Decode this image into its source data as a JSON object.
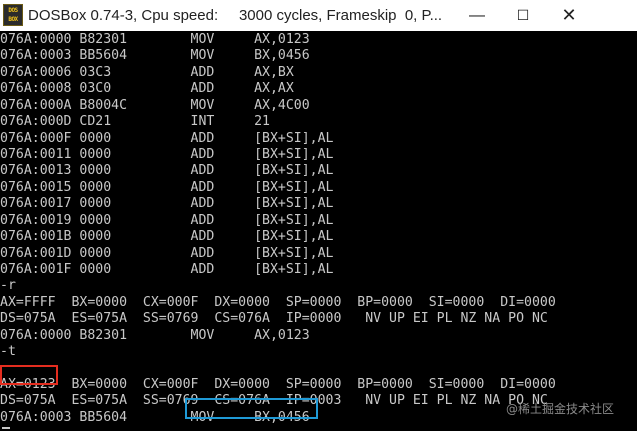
{
  "window": {
    "title": "DOSBox 0.74-3, Cpu speed:     3000 cycles, Frameskip  0, P...",
    "icon_line1": "DOS",
    "icon_line2": "BOX",
    "controls": {
      "minimize": "—",
      "maximize": "☐",
      "close": "✕"
    }
  },
  "terminal": {
    "lines": [
      "076A:0000 B82301        MOV     AX,0123",
      "076A:0003 BB5604        MOV     BX,0456",
      "076A:0006 03C3          ADD     AX,BX",
      "076A:0008 03C0          ADD     AX,AX",
      "076A:000A B8004C        MOV     AX,4C00",
      "076A:000D CD21          INT     21",
      "076A:000F 0000          ADD     [BX+SI],AL",
      "076A:0011 0000          ADD     [BX+SI],AL",
      "076A:0013 0000          ADD     [BX+SI],AL",
      "076A:0015 0000          ADD     [BX+SI],AL",
      "076A:0017 0000          ADD     [BX+SI],AL",
      "076A:0019 0000          ADD     [BX+SI],AL",
      "076A:001B 0000          ADD     [BX+SI],AL",
      "076A:001D 0000          ADD     [BX+SI],AL",
      "076A:001F 0000          ADD     [BX+SI],AL",
      "-r",
      "AX=FFFF  BX=0000  CX=000F  DX=0000  SP=0000  BP=0000  SI=0000  DI=0000",
      "DS=075A  ES=075A  SS=0769  CS=076A  IP=0000   NV UP EI PL NZ NA PO NC",
      "076A:0000 B82301        MOV     AX,0123",
      "-t",
      "",
      "AX=0123  BX=0000  CX=000F  DX=0000  SP=0000  BP=0000  SI=0000  DI=0000",
      "DS=075A  ES=075A  SS=0769  CS=076A  IP=0003   NV UP EI PL NZ NA PO NC",
      "076A:0003 BB5604        MOV     BX,0456"
    ],
    "cursor": "_"
  },
  "highlights": {
    "red_color": "#e52d1f",
    "blue_color": "#1f9ad6"
  },
  "watermark": "@稀土掘金技术社区"
}
